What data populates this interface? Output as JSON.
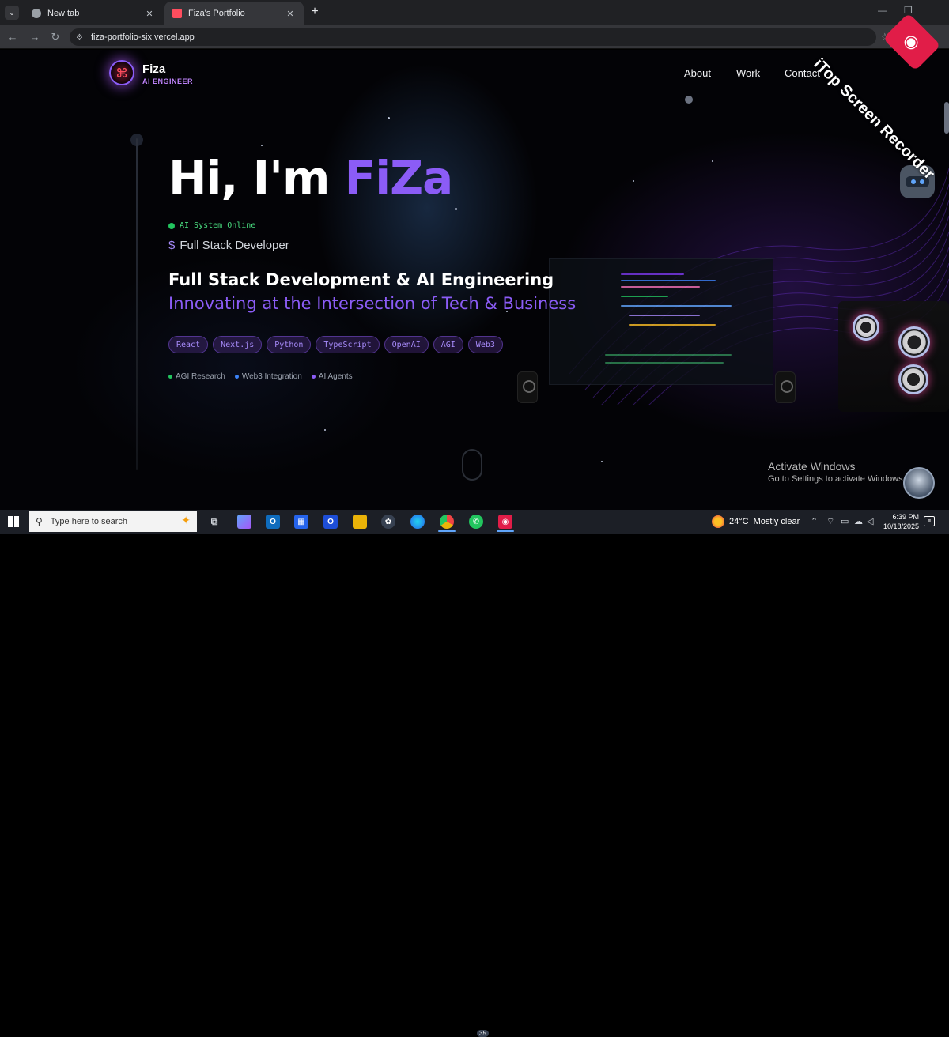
{
  "browser": {
    "tabs": [
      {
        "title": "New tab",
        "active": false
      },
      {
        "title": "Fiza's Portfolio",
        "active": true
      }
    ],
    "url": "fiza-portfolio-six.vercel.app"
  },
  "site": {
    "brand_name": "Fiza",
    "brand_sub": "AI ENGINEER",
    "nav": [
      "About",
      "Work",
      "Contact"
    ],
    "hero": {
      "greeting": "Hi, I'm ",
      "name": "FiZa",
      "status": "AI System Online",
      "role_symbol": "$",
      "role": "Full Stack Developer",
      "headline": "Full Stack Development & AI Engineering",
      "subline": "Innovating at the Intersection of Tech & Business",
      "chips": [
        "React",
        "Next.js",
        "Python",
        "TypeScript",
        "OpenAI",
        "AGI",
        "Web3"
      ],
      "tags": [
        {
          "label": "AGI Research",
          "color": "#22c55e"
        },
        {
          "label": "Web3 Integration",
          "color": "#3b82f6"
        },
        {
          "label": "AI Agents",
          "color": "#8b5cf6"
        }
      ]
    }
  },
  "overlay": {
    "activate_title": "Activate Windows",
    "activate_sub": "Go to Settings to activate Windows.",
    "watermark": "iTop Screen Recorder"
  },
  "taskbar": {
    "search_placeholder": "Type here to search",
    "whatsapp_badge": "35",
    "weather_temp": "24°C",
    "weather_desc": "Mostly clear",
    "time": "6:39 PM",
    "date": "10/18/2025"
  },
  "colors": {
    "accent": "#8b5cf6",
    "status_green": "#22c55e"
  }
}
